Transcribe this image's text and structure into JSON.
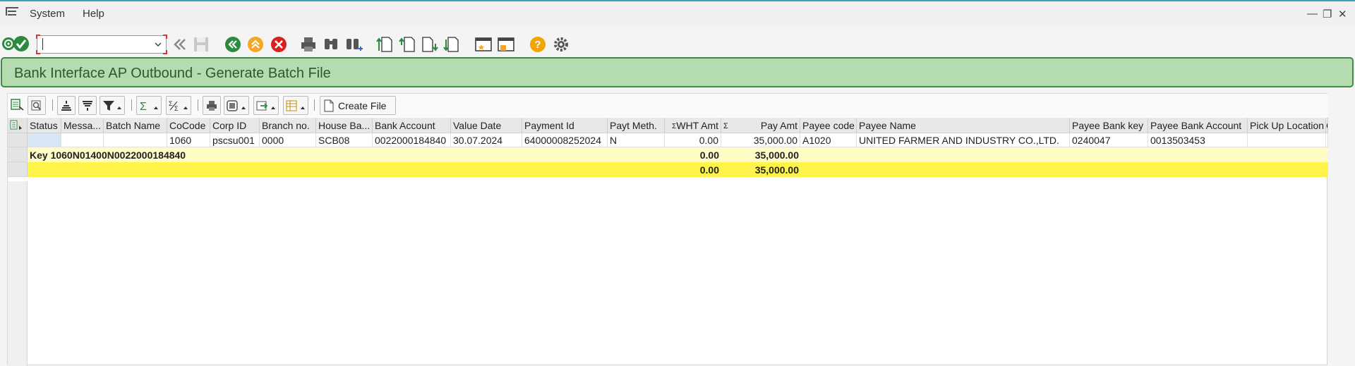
{
  "menubar": {
    "items": [
      "System",
      "Help"
    ],
    "window_controls": [
      "—",
      "❐",
      "✕"
    ]
  },
  "toolbar": {
    "command_value": "",
    "icons": [
      "enter-icon",
      "back-nav-icon",
      "save-icon",
      "back-icon",
      "exit-icon",
      "cancel-icon",
      "print-icon",
      "find-icon",
      "find-next-icon",
      "first-page-icon",
      "prev-page-icon",
      "next-page-icon",
      "last-page-icon",
      "new-session-icon",
      "shortcut-icon",
      "help-icon",
      "settings-icon"
    ]
  },
  "title": "Bank Interface AP Outbound - Generate Batch File",
  "alv_toolbar": {
    "create_file_label": "Create File"
  },
  "table": {
    "columns": [
      "Status",
      "Messa...",
      "Batch Name",
      "CoCode",
      "Corp ID",
      "Branch no.",
      "House Ba...",
      "Bank Account",
      "Value Date",
      "Payment Id",
      "Payt Meth.",
      "WHT Amt",
      "Pay Amt",
      "Payee code",
      "Payee Name",
      "Payee Bank key",
      "Payee Bank Account",
      "Pick Up Location",
      "C"
    ],
    "rows": [
      [
        "",
        "",
        "",
        "1060",
        "pscsu001",
        "0000",
        "SCB08",
        "0022000184840",
        "30.07.2024",
        "64000008252024",
        "N",
        "0.00",
        "35,000.00",
        "A1020",
        "UNITED FARMER AND INDUSTRY CO.,LTD.",
        "0240047",
        "0013503453",
        "",
        ""
      ]
    ],
    "subtotal": {
      "label": "Key 1060N01400N0022000184840",
      "wht": "0.00",
      "pay": "35,000.00"
    },
    "total": {
      "wht": "0.00",
      "pay": "35,000.00"
    }
  },
  "colors": {
    "title_bg": "#b4dcb0",
    "title_border": "#3c8f3c",
    "subtotal_bg": "#fffbc4",
    "total_bg": "#fff44a"
  }
}
